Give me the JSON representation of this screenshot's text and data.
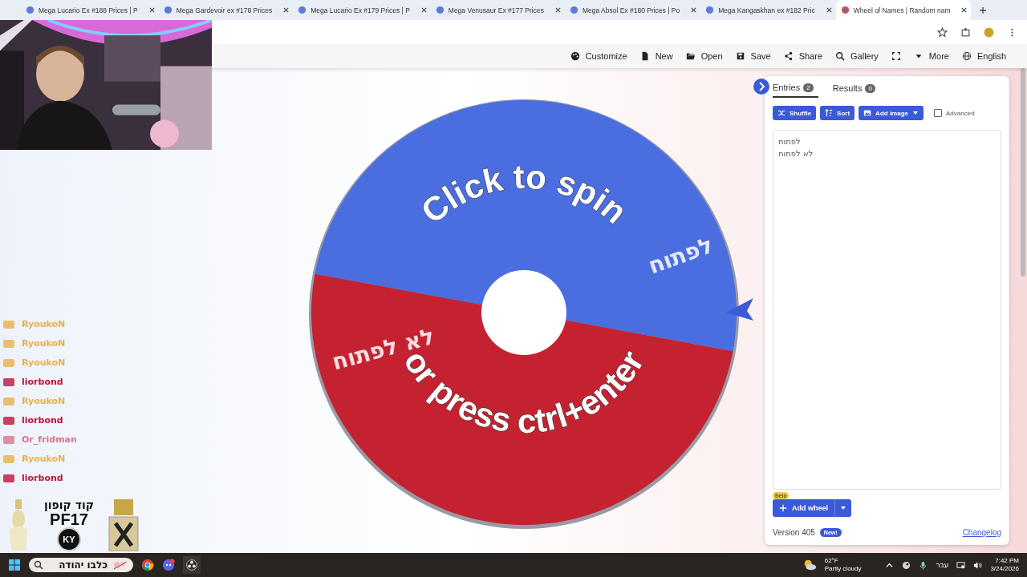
{
  "browser": {
    "tabs": [
      {
        "title": "Mega Lucario Ex #188 Prices | P",
        "selected": false
      },
      {
        "title": "Mega Gardevoir ex #178 Prices",
        "selected": false
      },
      {
        "title": "Mega Lucario Ex #179 Prices | P",
        "selected": false
      },
      {
        "title": "Mega Venusaur Ex #177 Prices",
        "selected": false
      },
      {
        "title": "Mega Absol Ex #180 Prices | Po",
        "selected": false
      },
      {
        "title": "Mega Kangaskhan ex #182 Pric",
        "selected": false
      },
      {
        "title": "Wheel of Names | Random nam",
        "selected": true
      }
    ]
  },
  "toolbar": {
    "items": [
      "Customize",
      "New",
      "Open",
      "Save",
      "Share",
      "Gallery",
      "More",
      "English"
    ]
  },
  "wheel": {
    "segments": [
      {
        "label": "לפתוח",
        "color": "#4a6ee0"
      },
      {
        "label": "לא לפתוח",
        "color": "#c52231"
      }
    ],
    "prompt": "Click to spin",
    "hint": "or press ctrl+enter"
  },
  "panel": {
    "tabs": [
      {
        "label": "Entries",
        "count": "2",
        "selected": true
      },
      {
        "label": "Results",
        "count": "0",
        "selected": false
      }
    ],
    "buttons": [
      "Shuffle",
      "Sort",
      "Add image"
    ],
    "advanced": {
      "label": "Advanced",
      "checked": false
    },
    "entries": [
      "לפתוח",
      "לא לפתוח"
    ],
    "add_wheel": {
      "label": "Add wheel",
      "badge": "Beta"
    },
    "version": "Version 405",
    "new_badge": "New!",
    "changelog": "Changelog"
  },
  "chat": [
    {
      "user": "RyoukoN",
      "color": "#e8b04a"
    },
    {
      "user": "RyoukoN",
      "color": "#e8b04a"
    },
    {
      "user": "RyoukoN",
      "color": "#e8b04a"
    },
    {
      "user": "liorbond",
      "color": "#c0133a"
    },
    {
      "user": "RyoukoN",
      "color": "#e8b04a"
    },
    {
      "user": "liorbond",
      "color": "#c0133a"
    },
    {
      "user": "Or_fridman",
      "color": "#d9738f"
    },
    {
      "user": "RyoukoN",
      "color": "#e8b04a"
    },
    {
      "user": "liorbond",
      "color": "#c0133a"
    }
  ],
  "ad": {
    "title": "קוד קופון",
    "code": "PF17",
    "logo": "KY"
  },
  "taskbar": {
    "search": "כלבו יהודה",
    "temperature": "62°F",
    "weather": "Partly cloudy",
    "language": "עבר",
    "time": "7:42 PM",
    "date": "3/24/2026"
  }
}
